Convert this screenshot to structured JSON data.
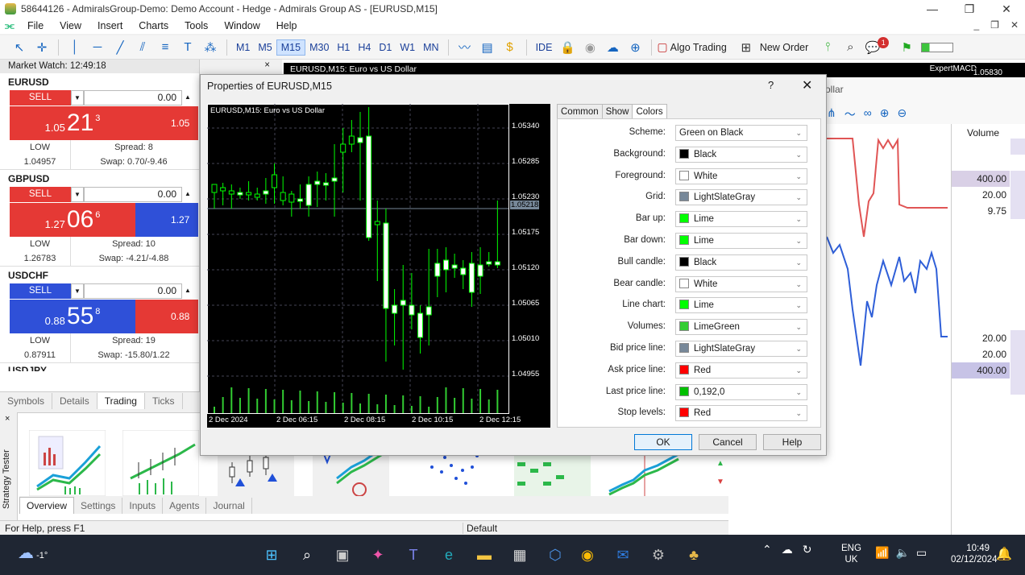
{
  "window": {
    "title": "58644126 - AdmiralsGroup-Demo: Demo Account - Hedge - Admirals Group AS - [EURUSD,M15]",
    "minimize": "—",
    "maximize": "❐",
    "close": "✕"
  },
  "menu": {
    "items": [
      "File",
      "View",
      "Insert",
      "Charts",
      "Tools",
      "Window",
      "Help"
    ],
    "right_controls": [
      "_",
      "❐",
      "✕"
    ]
  },
  "toolbar": {
    "timeframes": [
      "M1",
      "M5",
      "M15",
      "M30",
      "H1",
      "H4",
      "D1",
      "W1",
      "MN"
    ],
    "active_timeframe": "M15",
    "ide_label": "IDE",
    "algo_trading_label": "Algo Trading",
    "new_order_label": "New Order",
    "notification_count": "1"
  },
  "market_watch": {
    "header": "Market Watch: 12:49:18",
    "close_icon": "×",
    "symbols": [
      {
        "name": "EURUSD",
        "sell_label": "SELL",
        "lot": "0.00",
        "price_small": "1.05",
        "price_big": "21",
        "price_sup": "3",
        "price2": "1.05",
        "low_label": "LOW",
        "low": "1.04957",
        "spread": "Spread: 8",
        "swap": "Swap: 0.70/-9.46",
        "sell_color": "red",
        "buy_color": "red"
      },
      {
        "name": "GBPUSD",
        "sell_label": "SELL",
        "lot": "0.00",
        "price_small": "1.27",
        "price_big": "06",
        "price_sup": "6",
        "price2": "1.27",
        "low_label": "LOW",
        "low": "1.26783",
        "spread": "Spread: 10",
        "swap": "Swap: -4.21/-4.88",
        "sell_color": "red",
        "buy_color": "blue"
      },
      {
        "name": "USDCHF",
        "sell_label": "SELL",
        "lot": "0.00",
        "price_small": "0.88",
        "price_big": "55",
        "price_sup": "8",
        "price2": "0.88",
        "low_label": "LOW",
        "low": "0.87911",
        "spread": "Spread: 19",
        "swap": "Swap: -15.80/1.22",
        "sell_color": "blue",
        "buy_color": "red"
      }
    ],
    "partial_symbol": "USDJPY",
    "tabs": [
      "Symbols",
      "Details",
      "Trading",
      "Ticks"
    ],
    "active_tab": "Trading"
  },
  "chart": {
    "tab_label": "EURUSD,M15:  Euro vs US Dollar",
    "expert": "ExpertMACD",
    "price_tag": "1.05830",
    "indicator_title_fragment": "ollar",
    "volume_header": "Volume",
    "volume_cells": [
      "400.00",
      "20.00",
      "9.75",
      "20.00",
      "20.00",
      "400.00"
    ]
  },
  "dialog": {
    "title": "Properties of EURUSD,M15",
    "help": "?",
    "close": "✕",
    "preview_label": "EURUSD,M15:  Euro vs US Dollar",
    "price_labels": [
      "1.05340",
      "1.05285",
      "1.05230",
      "1.05175",
      "1.05120",
      "1.05065",
      "1.05010",
      "1.04955"
    ],
    "current_price": "1.05218",
    "time_labels": [
      "2 Dec 2024",
      "2 Dec 06:15",
      "2 Dec 08:15",
      "2 Dec 10:15",
      "2 Dec 12:15"
    ],
    "tabs": [
      "Common",
      "Show",
      "Colors"
    ],
    "active_tab": "Colors",
    "color_rows": [
      {
        "label": "Scheme:",
        "value": "Green on Black",
        "swatch": ""
      },
      {
        "label": "Background:",
        "value": "Black",
        "swatch": "#000000"
      },
      {
        "label": "Foreground:",
        "value": "White",
        "swatch": "#ffffff"
      },
      {
        "label": "Grid:",
        "value": "LightSlateGray",
        "swatch": "#778899"
      },
      {
        "label": "Bar up:",
        "value": "Lime",
        "swatch": "#00ff00"
      },
      {
        "label": "Bar down:",
        "value": "Lime",
        "swatch": "#00ff00"
      },
      {
        "label": "Bull candle:",
        "value": "Black",
        "swatch": "#000000"
      },
      {
        "label": "Bear candle:",
        "value": "White",
        "swatch": "#ffffff"
      },
      {
        "label": "Line chart:",
        "value": "Lime",
        "swatch": "#00ff00"
      },
      {
        "label": "Volumes:",
        "value": "LimeGreen",
        "swatch": "#32cd32"
      },
      {
        "label": "Bid price line:",
        "value": "LightSlateGray",
        "swatch": "#778899"
      },
      {
        "label": "Ask price line:",
        "value": "Red",
        "swatch": "#ff0000"
      },
      {
        "label": "Last price line:",
        "value": "0,192,0",
        "swatch": "#00c000"
      },
      {
        "label": "Stop levels:",
        "value": "Red",
        "swatch": "#ff0000"
      }
    ],
    "buttons": {
      "ok": "OK",
      "cancel": "Cancel",
      "help": "Help"
    }
  },
  "strategy_tester": {
    "side_label": "Strategy Tester",
    "close": "×",
    "tabs": [
      "Overview",
      "Settings",
      "Inputs",
      "Agents",
      "Journal"
    ],
    "active_tab": "Overview"
  },
  "status": {
    "help": "For Help, press F1",
    "profile": "Default"
  },
  "taskbar": {
    "weather": "-1°",
    "language_top": "ENG",
    "language_bottom": "UK",
    "time": "10:49",
    "date": "02/12/2024"
  }
}
